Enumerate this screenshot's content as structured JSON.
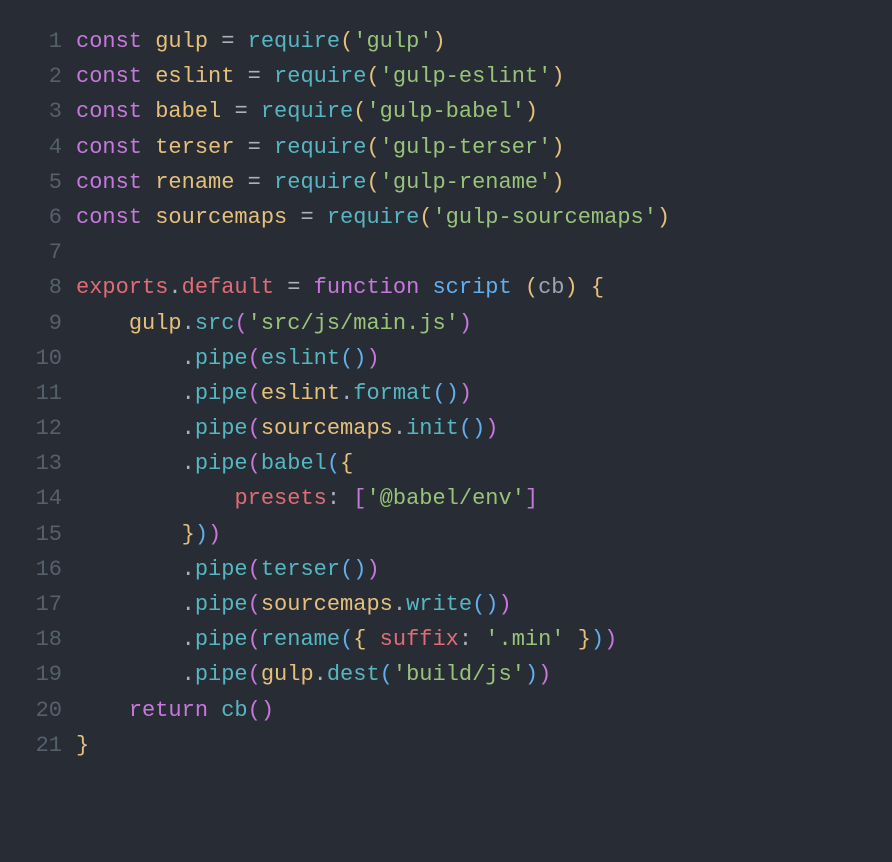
{
  "lines": [
    {
      "num": "1",
      "tokens": [
        {
          "c": "kw",
          "t": "const"
        },
        {
          "c": "pun",
          "t": " "
        },
        {
          "c": "var",
          "t": "gulp"
        },
        {
          "c": "pun",
          "t": " "
        },
        {
          "c": "pun",
          "t": "="
        },
        {
          "c": "pun",
          "t": " "
        },
        {
          "c": "fn",
          "t": "require"
        },
        {
          "c": "yel",
          "t": "("
        },
        {
          "c": "str",
          "t": "'gulp'"
        },
        {
          "c": "yel",
          "t": ")"
        }
      ]
    },
    {
      "num": "2",
      "tokens": [
        {
          "c": "kw",
          "t": "const"
        },
        {
          "c": "pun",
          "t": " "
        },
        {
          "c": "var",
          "t": "eslint"
        },
        {
          "c": "pun",
          "t": " "
        },
        {
          "c": "pun",
          "t": "="
        },
        {
          "c": "pun",
          "t": " "
        },
        {
          "c": "fn",
          "t": "require"
        },
        {
          "c": "yel",
          "t": "("
        },
        {
          "c": "str",
          "t": "'gulp-eslint'"
        },
        {
          "c": "yel",
          "t": ")"
        }
      ]
    },
    {
      "num": "3",
      "tokens": [
        {
          "c": "kw",
          "t": "const"
        },
        {
          "c": "pun",
          "t": " "
        },
        {
          "c": "var",
          "t": "babel"
        },
        {
          "c": "pun",
          "t": " "
        },
        {
          "c": "pun",
          "t": "="
        },
        {
          "c": "pun",
          "t": " "
        },
        {
          "c": "fn",
          "t": "require"
        },
        {
          "c": "yel",
          "t": "("
        },
        {
          "c": "str",
          "t": "'gulp-babel'"
        },
        {
          "c": "yel",
          "t": ")"
        }
      ]
    },
    {
      "num": "4",
      "tokens": [
        {
          "c": "kw",
          "t": "const"
        },
        {
          "c": "pun",
          "t": " "
        },
        {
          "c": "var",
          "t": "terser"
        },
        {
          "c": "pun",
          "t": " "
        },
        {
          "c": "pun",
          "t": "="
        },
        {
          "c": "pun",
          "t": " "
        },
        {
          "c": "fn",
          "t": "require"
        },
        {
          "c": "yel",
          "t": "("
        },
        {
          "c": "str",
          "t": "'gulp-terser'"
        },
        {
          "c": "yel",
          "t": ")"
        }
      ]
    },
    {
      "num": "5",
      "tokens": [
        {
          "c": "kw",
          "t": "const"
        },
        {
          "c": "pun",
          "t": " "
        },
        {
          "c": "var",
          "t": "rename"
        },
        {
          "c": "pun",
          "t": " "
        },
        {
          "c": "pun",
          "t": "="
        },
        {
          "c": "pun",
          "t": " "
        },
        {
          "c": "fn",
          "t": "require"
        },
        {
          "c": "yel",
          "t": "("
        },
        {
          "c": "str",
          "t": "'gulp-rename'"
        },
        {
          "c": "yel",
          "t": ")"
        }
      ]
    },
    {
      "num": "6",
      "tokens": [
        {
          "c": "kw",
          "t": "const"
        },
        {
          "c": "pun",
          "t": " "
        },
        {
          "c": "var",
          "t": "sourcemaps"
        },
        {
          "c": "pun",
          "t": " "
        },
        {
          "c": "pun",
          "t": "="
        },
        {
          "c": "pun",
          "t": " "
        },
        {
          "c": "fn",
          "t": "require"
        },
        {
          "c": "yel",
          "t": "("
        },
        {
          "c": "str",
          "t": "'gulp-sourcemaps'"
        },
        {
          "c": "yel",
          "t": ")"
        }
      ]
    },
    {
      "num": "7",
      "tokens": []
    },
    {
      "num": "8",
      "tokens": [
        {
          "c": "red",
          "t": "exports"
        },
        {
          "c": "pun",
          "t": "."
        },
        {
          "c": "red",
          "t": "default"
        },
        {
          "c": "pun",
          "t": " "
        },
        {
          "c": "pun",
          "t": "="
        },
        {
          "c": "pun",
          "t": " "
        },
        {
          "c": "kw",
          "t": "function"
        },
        {
          "c": "pun",
          "t": " "
        },
        {
          "c": "blu",
          "t": "script"
        },
        {
          "c": "pun",
          "t": " "
        },
        {
          "c": "yel",
          "t": "("
        },
        {
          "c": "par",
          "t": "cb"
        },
        {
          "c": "yel",
          "t": ")"
        },
        {
          "c": "pun",
          "t": " "
        },
        {
          "c": "yel",
          "t": "{"
        }
      ]
    },
    {
      "num": "9",
      "tokens": [
        {
          "c": "pun",
          "t": "    "
        },
        {
          "c": "var",
          "t": "gulp"
        },
        {
          "c": "pun",
          "t": "."
        },
        {
          "c": "prop",
          "t": "src"
        },
        {
          "c": "mag",
          "t": "("
        },
        {
          "c": "str",
          "t": "'src/js/main.js'"
        },
        {
          "c": "mag",
          "t": ")"
        }
      ]
    },
    {
      "num": "10",
      "tokens": [
        {
          "c": "pun",
          "t": "        "
        },
        {
          "c": "pun",
          "t": "."
        },
        {
          "c": "prop",
          "t": "pipe"
        },
        {
          "c": "mag",
          "t": "("
        },
        {
          "c": "fn",
          "t": "eslint"
        },
        {
          "c": "blu",
          "t": "("
        },
        {
          "c": "blu",
          "t": ")"
        },
        {
          "c": "mag",
          "t": ")"
        }
      ]
    },
    {
      "num": "11",
      "tokens": [
        {
          "c": "pun",
          "t": "        "
        },
        {
          "c": "pun",
          "t": "."
        },
        {
          "c": "prop",
          "t": "pipe"
        },
        {
          "c": "mag",
          "t": "("
        },
        {
          "c": "var",
          "t": "eslint"
        },
        {
          "c": "pun",
          "t": "."
        },
        {
          "c": "fn",
          "t": "format"
        },
        {
          "c": "blu",
          "t": "("
        },
        {
          "c": "blu",
          "t": ")"
        },
        {
          "c": "mag",
          "t": ")"
        }
      ]
    },
    {
      "num": "12",
      "tokens": [
        {
          "c": "pun",
          "t": "        "
        },
        {
          "c": "pun",
          "t": "."
        },
        {
          "c": "prop",
          "t": "pipe"
        },
        {
          "c": "mag",
          "t": "("
        },
        {
          "c": "var",
          "t": "sourcemaps"
        },
        {
          "c": "pun",
          "t": "."
        },
        {
          "c": "fn",
          "t": "init"
        },
        {
          "c": "blu",
          "t": "("
        },
        {
          "c": "blu",
          "t": ")"
        },
        {
          "c": "mag",
          "t": ")"
        }
      ]
    },
    {
      "num": "13",
      "tokens": [
        {
          "c": "pun",
          "t": "        "
        },
        {
          "c": "pun",
          "t": "."
        },
        {
          "c": "prop",
          "t": "pipe"
        },
        {
          "c": "mag",
          "t": "("
        },
        {
          "c": "fn",
          "t": "babel"
        },
        {
          "c": "blu",
          "t": "("
        },
        {
          "c": "yel",
          "t": "{"
        }
      ]
    },
    {
      "num": "14",
      "tokens": [
        {
          "c": "pun",
          "t": "            "
        },
        {
          "c": "red",
          "t": "presets"
        },
        {
          "c": "pun",
          "t": ": "
        },
        {
          "c": "mag",
          "t": "["
        },
        {
          "c": "str",
          "t": "'@babel/env'"
        },
        {
          "c": "mag",
          "t": "]"
        }
      ]
    },
    {
      "num": "15",
      "tokens": [
        {
          "c": "pun",
          "t": "        "
        },
        {
          "c": "yel",
          "t": "}"
        },
        {
          "c": "blu",
          "t": ")"
        },
        {
          "c": "mag",
          "t": ")"
        }
      ]
    },
    {
      "num": "16",
      "tokens": [
        {
          "c": "pun",
          "t": "        "
        },
        {
          "c": "pun",
          "t": "."
        },
        {
          "c": "prop",
          "t": "pipe"
        },
        {
          "c": "mag",
          "t": "("
        },
        {
          "c": "fn",
          "t": "terser"
        },
        {
          "c": "blu",
          "t": "("
        },
        {
          "c": "blu",
          "t": ")"
        },
        {
          "c": "mag",
          "t": ")"
        }
      ]
    },
    {
      "num": "17",
      "tokens": [
        {
          "c": "pun",
          "t": "        "
        },
        {
          "c": "pun",
          "t": "."
        },
        {
          "c": "prop",
          "t": "pipe"
        },
        {
          "c": "mag",
          "t": "("
        },
        {
          "c": "var",
          "t": "sourcemaps"
        },
        {
          "c": "pun",
          "t": "."
        },
        {
          "c": "fn",
          "t": "write"
        },
        {
          "c": "blu",
          "t": "("
        },
        {
          "c": "blu",
          "t": ")"
        },
        {
          "c": "mag",
          "t": ")"
        }
      ]
    },
    {
      "num": "18",
      "tokens": [
        {
          "c": "pun",
          "t": "        "
        },
        {
          "c": "pun",
          "t": "."
        },
        {
          "c": "prop",
          "t": "pipe"
        },
        {
          "c": "mag",
          "t": "("
        },
        {
          "c": "fn",
          "t": "rename"
        },
        {
          "c": "blu",
          "t": "("
        },
        {
          "c": "yel",
          "t": "{"
        },
        {
          "c": "pun",
          "t": " "
        },
        {
          "c": "red",
          "t": "suffix"
        },
        {
          "c": "pun",
          "t": ": "
        },
        {
          "c": "str",
          "t": "'.min'"
        },
        {
          "c": "pun",
          "t": " "
        },
        {
          "c": "yel",
          "t": "}"
        },
        {
          "c": "blu",
          "t": ")"
        },
        {
          "c": "mag",
          "t": ")"
        }
      ]
    },
    {
      "num": "19",
      "tokens": [
        {
          "c": "pun",
          "t": "        "
        },
        {
          "c": "pun",
          "t": "."
        },
        {
          "c": "prop",
          "t": "pipe"
        },
        {
          "c": "mag",
          "t": "("
        },
        {
          "c": "var",
          "t": "gulp"
        },
        {
          "c": "pun",
          "t": "."
        },
        {
          "c": "fn",
          "t": "dest"
        },
        {
          "c": "blu",
          "t": "("
        },
        {
          "c": "str",
          "t": "'build/js'"
        },
        {
          "c": "blu",
          "t": ")"
        },
        {
          "c": "mag",
          "t": ")"
        }
      ]
    },
    {
      "num": "20",
      "tokens": [
        {
          "c": "pun",
          "t": "    "
        },
        {
          "c": "kw",
          "t": "return"
        },
        {
          "c": "pun",
          "t": " "
        },
        {
          "c": "fn",
          "t": "cb"
        },
        {
          "c": "mag",
          "t": "("
        },
        {
          "c": "mag",
          "t": ")"
        }
      ]
    },
    {
      "num": "21",
      "tokens": [
        {
          "c": "yel",
          "t": "}"
        }
      ]
    }
  ]
}
